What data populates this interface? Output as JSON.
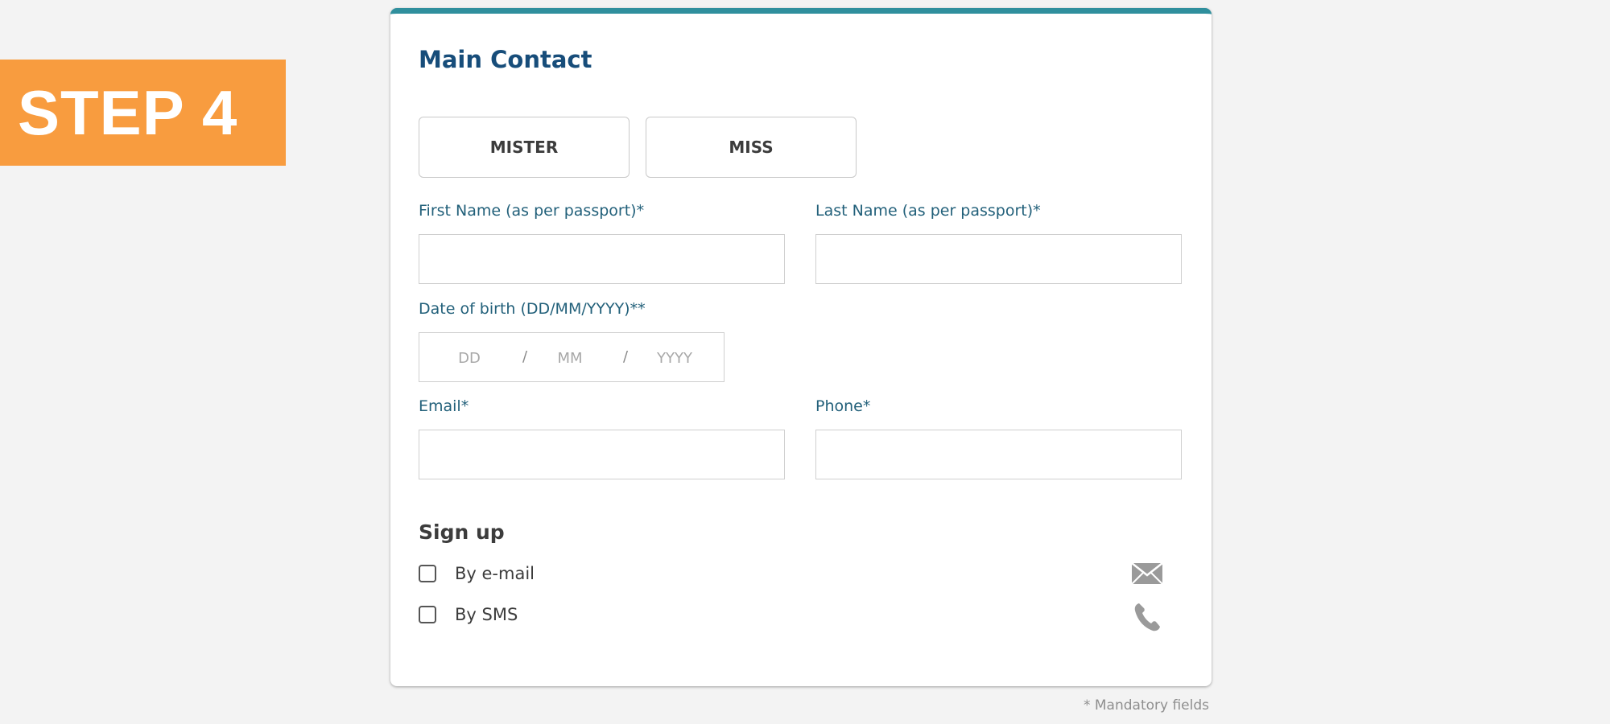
{
  "step_badge": {
    "label": "STEP 4"
  },
  "card": {
    "title": "Main Contact",
    "title_buttons": {
      "mister": "MISTER",
      "miss": "MISS"
    },
    "first_name": {
      "label": "First Name (as per passport)*",
      "value": "",
      "placeholder": ""
    },
    "last_name": {
      "label": "Last Name (as per passport)*",
      "value": "",
      "placeholder": ""
    },
    "dob": {
      "label": "Date of birth (DD/MM/YYYY)**",
      "day_placeholder": "DD",
      "month_placeholder": "MM",
      "year_placeholder": "YYYY",
      "separator": "/"
    },
    "email": {
      "label": "Email*",
      "value": "",
      "placeholder": ""
    },
    "phone": {
      "label": "Phone*",
      "value": "",
      "placeholder": ""
    },
    "signup": {
      "title": "Sign up",
      "options": [
        {
          "label": "By e-mail",
          "checked": false,
          "icon": "envelope-icon"
        },
        {
          "label": "By SMS",
          "checked": false,
          "icon": "phone-icon"
        }
      ]
    }
  },
  "footer": {
    "mandatory_note": "* Mandatory fields"
  },
  "colors": {
    "accent_bar": "#2f8f9d",
    "step_badge": "#f89c3f",
    "title": "#174d7a",
    "label": "#22607a"
  }
}
